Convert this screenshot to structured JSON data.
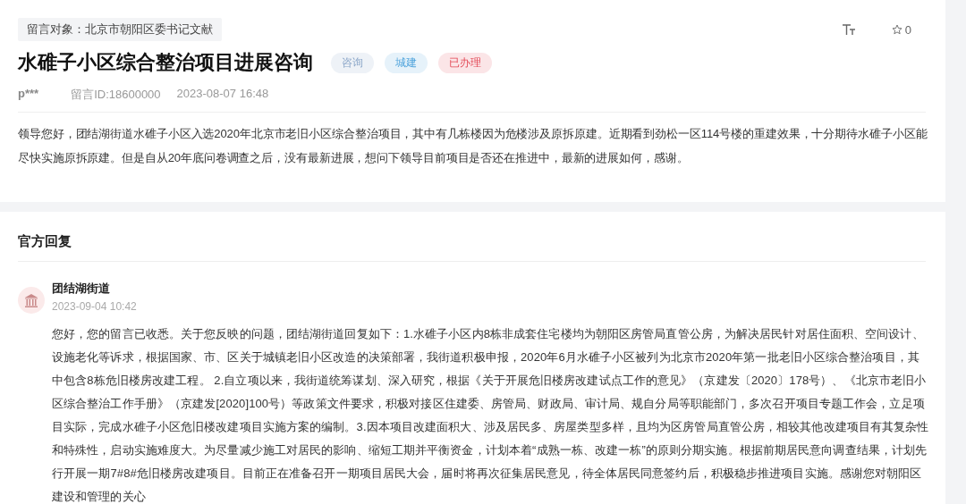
{
  "target": {
    "label": "留言对象：北京市朝阳区委书记文献"
  },
  "toolbar": {
    "star_count": "0"
  },
  "title": "水碓子小区综合整治项目进展咨询",
  "tags": [
    {
      "label": "咨询",
      "color": "#eef2f7"
    },
    {
      "label": "城建",
      "color": "#e6f2fa"
    },
    {
      "label": "已办理",
      "color": "#fbe5e7"
    }
  ],
  "meta": {
    "author": "p***",
    "message_id": "留言ID:18600000",
    "time": "2023-08-07 16:48"
  },
  "question": "领导您好，团结湖街道水碓子小区入选2020年北京市老旧小区综合整治项目，其中有几栋楼因为危楼涉及原拆原建。近期看到劲松一区114号楼的重建效果，十分期待水碓子小区能尽快实施原拆原建。但是自从20年底问卷调查之后，没有最新进展，想问下领导目前项目是否还在推进中，最新的进展如何，感谢。",
  "reply_section": {
    "heading": "官方回复",
    "replier": "团结湖街道",
    "time": "2023-09-04 10:42",
    "text": "您好，您的留言已收悉。关于您反映的问题，团结湖街道回复如下：1.水碓子小区内8栋非成套住宅楼均为朝阳区房管局直管公房，为解决居民针对居住面积、空间设计、设施老化等诉求，根据国家、市、区关于城镇老旧小区改造的决策部署，我街道积极申报，2020年6月水碓子小区被列为北京市2020年第一批老旧小区综合整治项目，其中包含8栋危旧楼房改建工程。 2.自立项以来，我街道统筹谋划、深入研究，根据《关于开展危旧楼房改建试点工作的意见》（京建发〔2020〕178号）、《北京市老旧小区综合整治工作手册》（京建发[2020]100号）等政策文件要求，积极对接区住建委、房管局、财政局、审计局、规自分局等职能部门，多次召开项目专题工作会，立足项目实际，完成水碓子小区危旧楼改建项目实施方案的编制。3.因本项目改建面积大、涉及居民多、房屋类型多样，且均为区房管局直管公房，相较其他改建项目有其复杂性和特殊性，启动实施难度大。为尽量减少施工对居民的影响、缩短工期并平衡资金，计划本着“成熟一栋、改建一栋”的原则分期实施。根据前期居民意向调查结果，计划先行开展一期7#8#危旧楼房改建项目。目前正在准备召开一期项目居民大会，届时将再次征集居民意见，待全体居民同意签约后，积极稳步推进项目实施。感谢您对朝阳区建设和管理的关心"
  }
}
